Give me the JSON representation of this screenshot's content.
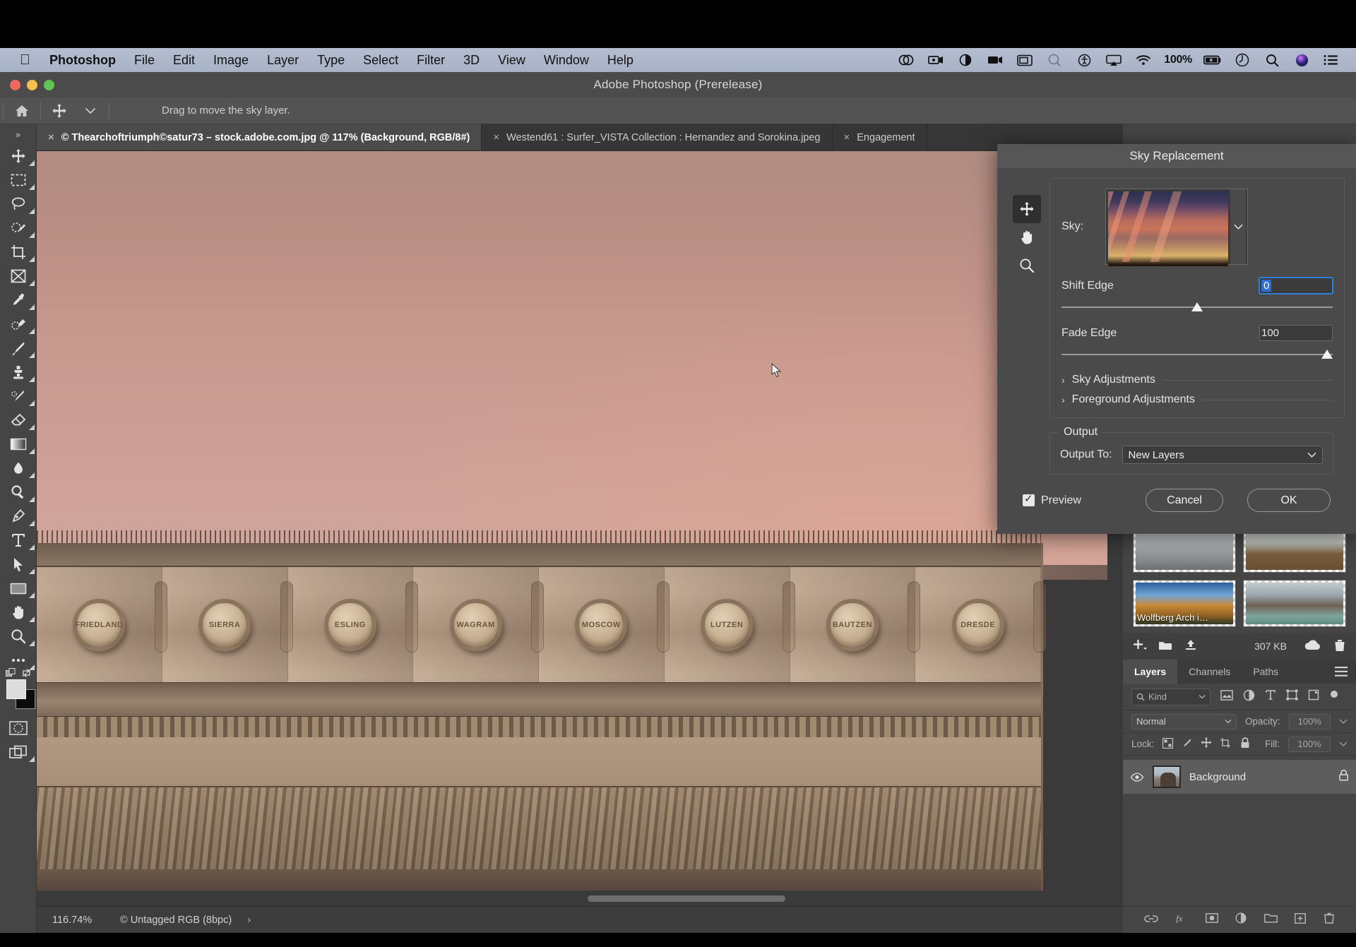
{
  "menubar": {
    "apple_icon": "apple-logo-icon",
    "items": [
      "Photoshop",
      "File",
      "Edit",
      "Image",
      "Layer",
      "Type",
      "Select",
      "Filter",
      "3D",
      "View",
      "Window",
      "Help"
    ],
    "status": {
      "icons": [
        "creative-cloud-icon",
        "screen-record-icon",
        "contrast-icon",
        "video-icon",
        "window-icon",
        "magnifier-disabled-icon",
        "accessibility-icon",
        "airplay-icon",
        "wifi-icon"
      ],
      "battery_percent": "100%",
      "battery_icon": "battery-charging-icon",
      "right_icons": [
        "time-machine-icon",
        "spotlight-search-icon",
        "siri-icon",
        "control-center-icon"
      ]
    }
  },
  "window": {
    "title": "Adobe Photoshop (Prerelease)",
    "traffic_lights": [
      "close-button",
      "minimize-button",
      "zoom-button"
    ]
  },
  "options_bar": {
    "home_icon": "home-icon",
    "tool_icon": "move-tool-icon",
    "tool_dropdown_icon": "chevron-down-icon",
    "hint": "Drag to move the sky layer."
  },
  "toolbar": {
    "collapse_icon": "double-chevron-right-icon",
    "tools": [
      "move-tool-icon",
      "rectangular-marquee-tool-icon",
      "lasso-tool-icon",
      "object-selection-tool-icon",
      "crop-tool-icon",
      "frame-tool-icon",
      "eyedropper-tool-icon",
      "spot-healing-brush-tool-icon",
      "brush-tool-icon",
      "clone-stamp-tool-icon",
      "history-brush-tool-icon",
      "eraser-tool-icon",
      "gradient-tool-icon",
      "blur-tool-icon",
      "dodge-tool-icon",
      "pen-tool-icon",
      "type-tool-icon",
      "path-selection-tool-icon",
      "rectangle-tool-icon",
      "hand-tool-icon",
      "zoom-tool-icon",
      "edit-toolbar-icon"
    ],
    "foreground_color": "#dcdcdc",
    "background_color": "#0c0c0c",
    "quick_mask_icon": "quick-mask-icon",
    "screen_mode_icon": "screen-mode-icon"
  },
  "tabs": [
    {
      "title": "© Thearchoftriumph©satur73 – stock.adobe.com.jpg @ 117% (Background, RGB/8#)",
      "active": true
    },
    {
      "title": "Westend61 : Surfer_VISTA Collection : Hernandez and Sorokina.jpeg",
      "active": false
    },
    {
      "title": "Engagement",
      "active": false
    }
  ],
  "canvas": {
    "monument_shields": [
      "FRIEDLAND",
      "SIERRA",
      "ESLING",
      "WAGRAM",
      "MOSCOW",
      "LUTZEN",
      "BAUTZEN",
      "DRESDE"
    ],
    "cursor_icon": "arrow-cursor-icon"
  },
  "status_bar": {
    "zoom": "116.74%",
    "color_space": "© Untagged RGB (8bpc)",
    "expand_icon": "chevron-right-icon"
  },
  "sky_presets": {
    "items": [
      {
        "caption": "",
        "thumb": "helicopter-beach-thumb"
      },
      {
        "caption": "",
        "thumb": "white-dress-field-thumb"
      },
      {
        "caption": "Wolfberg Arch i…",
        "thumb": "wolfberg-arch-thumb"
      },
      {
        "caption": "",
        "thumb": "sea-arch-thumb"
      }
    ],
    "footer": {
      "add_icon": "add-plus-icon",
      "folder_icon": "new-folder-icon",
      "upload_icon": "upload-icon",
      "size": "307 KB",
      "cloud_icon": "cloud-icon",
      "trash_icon": "trash-icon"
    }
  },
  "layers_panel": {
    "tabs": [
      "Layers",
      "Channels",
      "Paths"
    ],
    "active_tab": "Layers",
    "menu_icon": "panel-menu-icon",
    "filter": {
      "search_icon": "search-icon",
      "kind_label": "Kind",
      "dropdown_icon": "chevron-down-icon",
      "filter_icons": [
        "pixel-layer-filter-icon",
        "adjustment-layer-filter-icon",
        "type-layer-filter-icon",
        "shape-layer-filter-icon",
        "smart-object-filter-icon"
      ],
      "toggle_icon": "filter-toggle-icon"
    },
    "blend_mode": "Normal",
    "opacity_label": "Opacity:",
    "opacity_value": "100%",
    "lock_label": "Lock:",
    "lock_icons": [
      "lock-transparent-pixels-icon",
      "lock-image-pixels-icon",
      "lock-position-icon",
      "lock-artboard-nesting-icon",
      "lock-all-icon"
    ],
    "fill_label": "Fill:",
    "fill_value": "100%",
    "layers": [
      {
        "name": "Background",
        "visible": true,
        "locked": true,
        "visibility_icon": "eye-icon",
        "lock_icon": "lock-icon"
      }
    ],
    "bottom_icons": [
      "link-layers-icon",
      "layer-style-fx-icon",
      "add-layer-mask-icon",
      "new-adjustment-layer-icon",
      "new-group-icon",
      "new-layer-icon",
      "delete-layer-icon"
    ]
  },
  "sky_replacement_dialog": {
    "title": "Sky Replacement",
    "tools": [
      {
        "icon": "move-tool-icon",
        "active": true
      },
      {
        "icon": "hand-tool-icon",
        "active": false
      },
      {
        "icon": "zoom-tool-icon",
        "active": false
      }
    ],
    "sky_label": "Sky:",
    "sky_thumb": "sunset-clouds-sky-thumb",
    "sky_dropdown_icon": "chevron-down-icon",
    "shift_edge": {
      "label": "Shift Edge",
      "value": "0",
      "slider_percent": 50
    },
    "fade_edge": {
      "label": "Fade Edge",
      "value": "100",
      "slider_percent": 100
    },
    "accordions": [
      {
        "label": "Sky Adjustments",
        "icon": "chevron-right-icon",
        "expanded": false
      },
      {
        "label": "Foreground Adjustments",
        "icon": "chevron-right-icon",
        "expanded": false
      }
    ],
    "output": {
      "legend": "Output",
      "label": "Output To:",
      "value": "New Layers",
      "dropdown_icon": "chevron-down-icon"
    },
    "preview": {
      "label": "Preview",
      "checked": true
    },
    "cancel_label": "Cancel",
    "ok_label": "OK"
  }
}
